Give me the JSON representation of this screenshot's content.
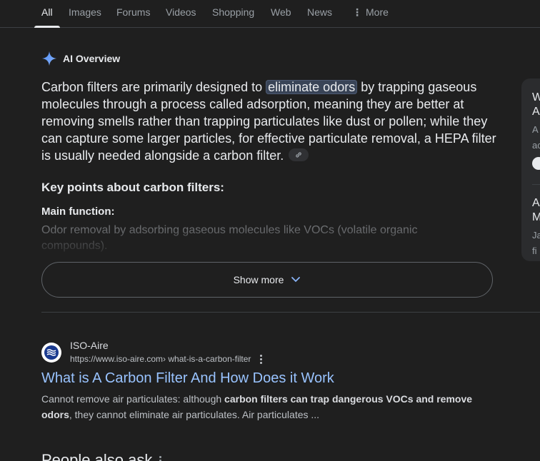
{
  "tabs": [
    {
      "label": "All",
      "active": true
    },
    {
      "label": "Images"
    },
    {
      "label": "Forums"
    },
    {
      "label": "Videos"
    },
    {
      "label": "Shopping"
    },
    {
      "label": "Web"
    },
    {
      "label": "News"
    },
    {
      "label": "More"
    }
  ],
  "ai_overview": {
    "title": "AI Overview",
    "text_before": "Carbon filters are primarily designed to ",
    "highlight": "eliminate odors",
    "text_after": " by trapping gaseous molecules through a process called adsorption, meaning they are better at removing smells rather than trapping particulates like dust or pollen; while they can capture some larger particles, for effective particulate removal, a HEPA filter is usually needed alongside a carbon filter.",
    "key_points_heading": "Key points about carbon filters:",
    "main_function_heading": "Main function:",
    "main_function_text": "Odor removal by adsorbing gaseous molecules like VOCs (volatile organic compounds).",
    "show_more": "Show more"
  },
  "side_card": {
    "line1": "W",
    "line2": "A",
    "line3": "A",
    "line4": "ac",
    "line5": "A",
    "line6": "M",
    "line7": "Ja",
    "line8": "fi"
  },
  "result": {
    "site_name": "ISO-Aire",
    "url": "https://www.iso-aire.com",
    "url_path": " › what-is-a-carbon-filter",
    "title": "What is A Carbon Filter And How Does it Work",
    "snippet_1": "Cannot remove air particulates: although ",
    "snippet_bold": "carbon filters can trap dangerous VOCs and remove odors",
    "snippet_2": ", they cannot eliminate air particulates. Air particulates ..."
  },
  "people_also_ask": "People also ask",
  "colors": {
    "background": "#1f1f1f",
    "link": "#99c3ff",
    "highlight": "#394457"
  }
}
